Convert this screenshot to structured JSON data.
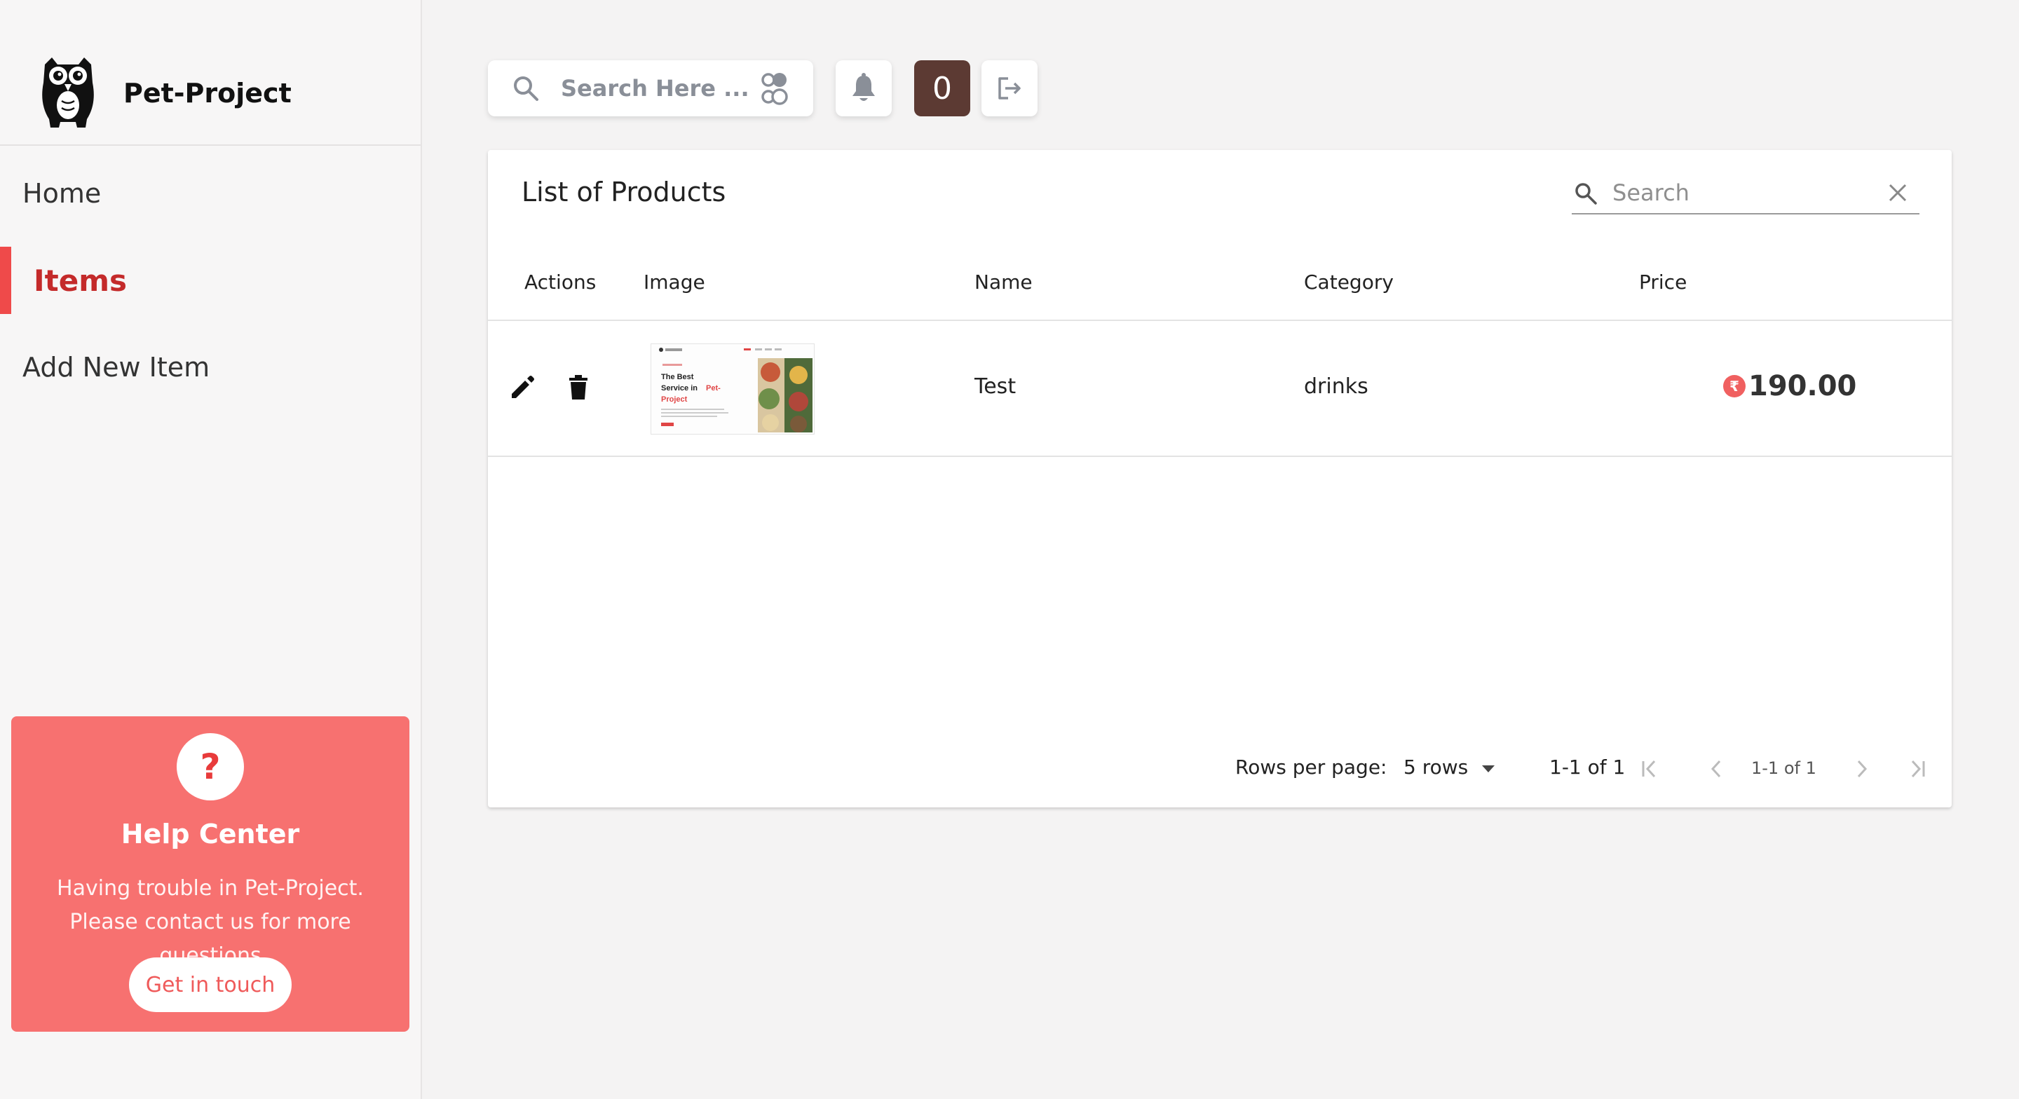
{
  "brand": {
    "name": "Pet-Project"
  },
  "sidebar": {
    "items": [
      {
        "label": "Home",
        "active": false
      },
      {
        "label": "Items",
        "active": true
      },
      {
        "label": "Add New Item",
        "active": false
      }
    ],
    "help": {
      "icon_text": "?",
      "title": "Help Center",
      "text": "Having trouble in Pet-Project. Please contact us for more questions",
      "button": "Get in touch"
    }
  },
  "topbar": {
    "search_placeholder": "Search Here ...",
    "cart_count": "0",
    "icons": [
      "search-icon",
      "filter-toggle-icon",
      "bell-icon",
      "logout-icon"
    ]
  },
  "products": {
    "title": "List of Products",
    "search_placeholder": "Search",
    "columns": [
      "Actions",
      "Image",
      "Name",
      "Category",
      "Price"
    ],
    "rows": [
      {
        "name": "Test",
        "category": "drinks",
        "price": "190.00",
        "currency_symbol": "₹",
        "thumb": {
          "heading_line1": "The Best",
          "heading_line2": "Service in",
          "heading_accent": "Pet-",
          "heading_line3": "Project"
        }
      }
    ],
    "pagination": {
      "rows_per_page_label": "Rows per page:",
      "rows_per_page_value": "5 rows",
      "range": "1-1 of 1",
      "range_small": "1-1 of 1"
    }
  },
  "colors": {
    "accent": "#ef4a4a",
    "active_text": "#c42a2a",
    "help_bg": "#f77170",
    "cart_bg": "#5c3a33",
    "page_bg": "#f4f3f3"
  }
}
